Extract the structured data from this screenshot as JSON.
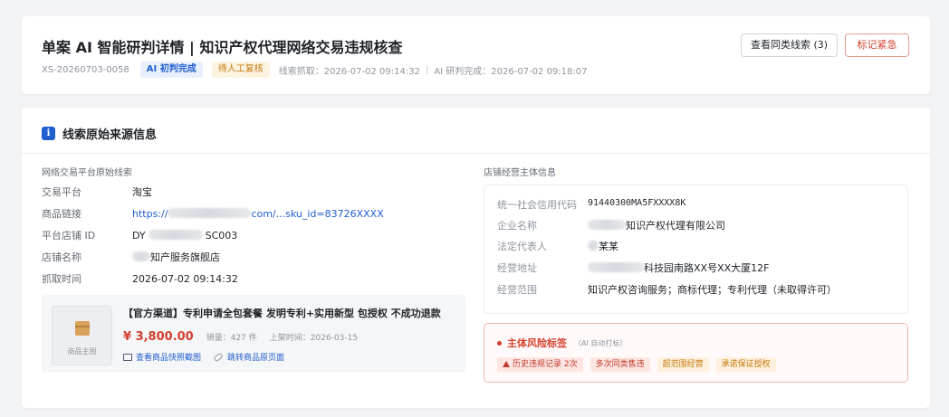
{
  "header": {
    "title": "单案 AI 智能研判详情 | 知识产权代理网络交易违规核查",
    "case_id": "XS-20260703-0058",
    "ai_tag": "AI 初判完成",
    "pending_tag": "待人工复核",
    "capture_time": "线索抓取：2026-07-02 09:14:32",
    "separator": "|",
    "ai_time": "AI 研判完成：2026-07-02 09:18:07",
    "btn_similar": "查看同类线索 (3)",
    "btn_urgent": "标记紧急"
  },
  "source": {
    "section_title": "线索原始来源信息",
    "info_icon": "i",
    "left_title": "网络交易平台原始线索",
    "platform_label": "交易平台",
    "platform_value": "淘宝",
    "link_label": "商品链接",
    "link_prefix": "https://",
    "link_suffix": "com/...sku_id=83726XXXX",
    "shop_id_label": "平台店铺 ID",
    "shop_id_prefix": "DY",
    "shop_id_suffix": "SC003",
    "shop_name_label": "店铺名称",
    "shop_name_suffix": "知产服务旗舰店",
    "capture_label": "抓取时间",
    "capture_value": "2026-07-02 09:14:32"
  },
  "product": {
    "thumb_label": "商品主图",
    "name": "【官方渠道】专利申请全包套餐 发明专利+实用新型 包授权 不成功退款",
    "price": "¥ 3,800.00",
    "sales": "销量：427 件",
    "listed": "上架时间：2026-03-15",
    "link_snapshot": "查看商品快照截图",
    "link_original": "跳转商品原页面"
  },
  "entity": {
    "title": "店铺经营主体信息",
    "credit_label": "统一社会信用代码",
    "credit_value": "91440300MA5FXXXX8K",
    "company_label": "企业名称",
    "company_suffix": "知识产权代理有限公司",
    "rep_label": "法定代表人",
    "rep_suffix": "某某",
    "address_label": "经营地址",
    "address_suffix": "科技园南路XX号XX大厦12F",
    "scope_label": "经营范围",
    "scope_value": "知识产权咨询服务；商标代理；专利代理（未取得许可）"
  },
  "risk": {
    "title": "主体风险标签",
    "note": "（AI 自动打标）",
    "tags": [
      "历史违规记录 2次",
      "多次同类售违",
      "超范围经营",
      "承诺保证授权"
    ]
  },
  "colors": {
    "primary": "#1f5fd0",
    "danger": "#d4402f",
    "warning": "#c57a0e"
  }
}
